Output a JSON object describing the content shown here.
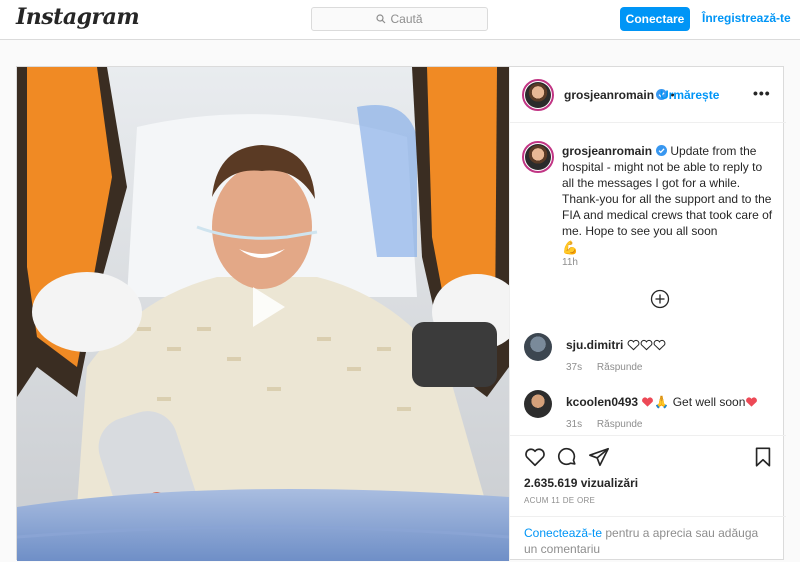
{
  "header": {
    "logo": "Instagram",
    "search_placeholder": "Caută",
    "login_label": "Conectare",
    "signup_label": "Înregistrează-te"
  },
  "post": {
    "username": "grosjeanromain",
    "follow_label": "Urmărește",
    "more_label": "•••",
    "caption": "Update from the hospital - might not be able to reply to all the messages I got for a while. Thank-you for all the support and to the FIA and medical crews that took care of me. Hope to see you all soon",
    "caption_emoji": "💪",
    "caption_time": "11h",
    "comments": [
      {
        "username": "sju.dimitri",
        "text": "",
        "hearts": 3,
        "time": "37s",
        "reply_label": "Răspunde"
      },
      {
        "username": "kcoolen0493",
        "text": "Get well soon",
        "time": "31s",
        "reply_label": "Răspunde"
      }
    ],
    "views": "2.635.619 vizualizări",
    "posted_ago": "ACUM 11 DE ORE",
    "login_link": "Conectează-te",
    "login_prompt": " pentru a aprecia sau adăuga un comentariu"
  },
  "colors": {
    "accent": "#0095f6",
    "verified": "#3897f0",
    "heart": "#ed4956"
  }
}
